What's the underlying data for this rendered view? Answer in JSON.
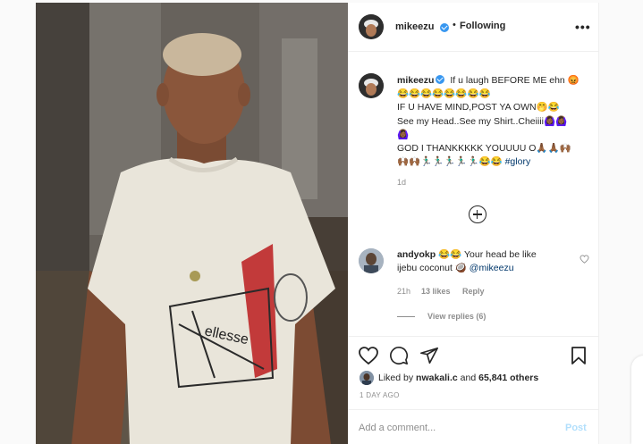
{
  "header": {
    "username": "mikeezu",
    "separator": "•",
    "follow_status": "Following",
    "more_icon": "ellipsis-icon"
  },
  "caption": {
    "username": "mikeezu",
    "line1": "If u laugh BEFORE ME ehn 😡",
    "line2": "😂😂😂😂😂😂😂😂",
    "line3": "IF U HAVE MIND,POST YA OWN🤭😂",
    "line4": "See my Head..See my Shirt..Cheiiii🙆🏾‍♀️🙆🏾‍♀️",
    "line5": "🙆🏾‍♀️",
    "line6": "GOD I THANKKKKK YOUUUU O🙏🏾🙏🏾🙌🏾",
    "line7": "🙌🏾🙌🏾🏃🏽‍♂️🏃🏽‍♂️🏃🏽‍♂️🏃🏽‍♂️🏃🏽‍♂️😂😂",
    "hashtag": "#glory",
    "time": "1d"
  },
  "comment": {
    "username": "andyokp",
    "emoji": "😂😂",
    "text_part1": "Your head be like",
    "text_part2": "ijebu coconut 🥥",
    "mention": "@mikeezu",
    "time": "21h",
    "likes": "13 likes",
    "reply": "Reply",
    "view_replies": "View replies (6)"
  },
  "actions": {
    "liked_by_prefix": "Liked by",
    "liked_by_user": "nwakali.c",
    "liked_by_and": "and",
    "liked_by_others": "65,841 others",
    "date": "1 DAY AGO"
  },
  "comment_box": {
    "placeholder": "Add a comment...",
    "post_label": "Post"
  },
  "colors": {
    "text": "#262626",
    "muted": "#8e8e8e",
    "link": "#00376b",
    "verified": "#3897f0",
    "post_disabled": "#b2dffc"
  }
}
